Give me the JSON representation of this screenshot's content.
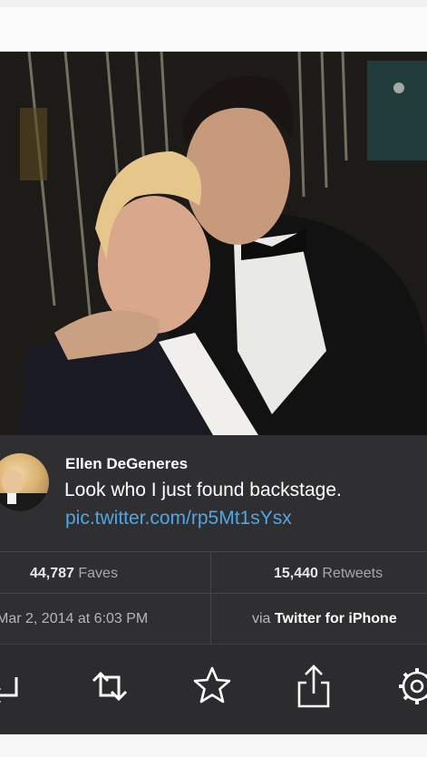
{
  "tweet": {
    "author_name": "Ellen DeGeneres",
    "text": "Look who I just found backstage.",
    "link": "pic.twitter.com/rp5Mt1sYsx",
    "faves_count": "44,787",
    "faves_label": " Faves",
    "retweets_count": "15,440",
    "retweets_label": " Retweets",
    "date": "Mar 2, 2014 at 6:03 PM",
    "via_prefix": "via ",
    "via_source": "Twitter for iPhone"
  },
  "actions": [
    {
      "name": "reply",
      "icon": "reply-icon"
    },
    {
      "name": "retweet",
      "icon": "retweet-icon"
    },
    {
      "name": "favorite",
      "icon": "star-icon"
    },
    {
      "name": "share",
      "icon": "share-icon"
    },
    {
      "name": "settings",
      "icon": "gear-icon"
    }
  ],
  "colors": {
    "card_background": "#2f2f31",
    "link": "#4ea7e8",
    "muted_text": "#a9a9ad"
  }
}
